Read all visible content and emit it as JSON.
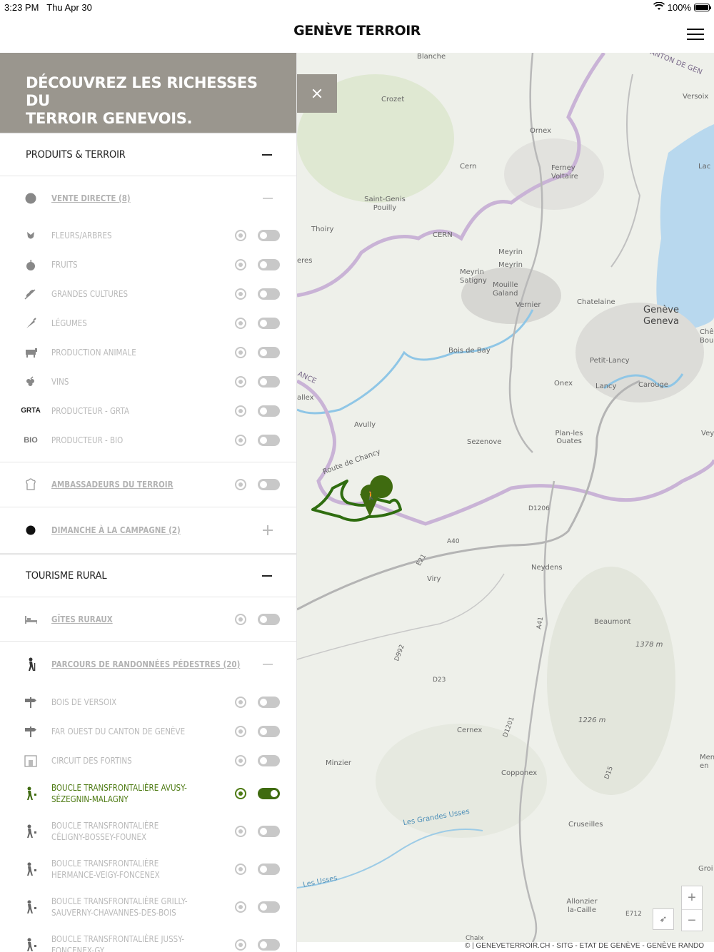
{
  "status": {
    "time": "3:23 PM",
    "date": "Thu Apr 30",
    "battery": "100%"
  },
  "header": {
    "brand": "GENÈVE TERROIR"
  },
  "banner": {
    "line1": "DÉCOUVREZ LES RICHESSES DU",
    "line2": "TERROIR GENEVOIS."
  },
  "sections": {
    "produits": "PRODUITS & TERROIR",
    "tourisme": "TOURISME RURAL"
  },
  "vente": {
    "title": "VENTE DIRECTE (8)",
    "items": [
      "FLEURS/ARBRES",
      "FRUITS",
      "GRANDES CULTURES",
      "LÉGUMES",
      "PRODUCTION ANIMALE",
      "VINS",
      "PRODUCTEUR - GRTA",
      "PRODUCTEUR - BIO"
    ]
  },
  "ambassadeurs": "AMBASSADEURS DU TERROIR",
  "dimanche": "DIMANCHE À LA CAMPAGNE (2)",
  "gites": "GÎTES RURAUX",
  "parcours": {
    "title": "PARCOURS DE RANDONNÉES PÉDESTRES (20)",
    "items": [
      {
        "label": "BOIS DE VERSOIX",
        "active": false
      },
      {
        "label": "FAR OUEST DU CANTON DE GENÈVE",
        "active": false
      },
      {
        "label": "CIRCUIT DES FORTINS",
        "active": false
      },
      {
        "label": "BOUCLE TRANSFRONTALIÈRE AVUSY-SÉZEGNIN-MALAGNY",
        "active": true
      },
      {
        "label": "BOUCLE TRANSFRONTALIÈRE CÉLIGNY-BOSSEY-FOUNEX",
        "active": false
      },
      {
        "label": "BOUCLE TRANSFRONTALIÈRE HERMANCE-VEIGY-FONCENEX",
        "active": false
      },
      {
        "label": "BOUCLE TRANSFRONTALIÈRE GRILLY-SAUVERNY-CHAVANNES-DES-BOIS",
        "active": false
      },
      {
        "label": "BOUCLE TRANSFRONTALIÈRE JUSSY-FONCENEX-GY",
        "active": false
      }
    ]
  },
  "icons": {
    "grta": "GRTA",
    "bio": "BIO"
  },
  "map": {
    "labels": [
      "Blanche",
      "Crozet",
      "Ornex",
      "Versoix",
      "Cern",
      "Ferney Voltaire",
      "Lac",
      "Saint-Genis Pouilly",
      "Thoiry",
      "CERN",
      "Meyrin",
      "Meyrin",
      "Meyrin Satigny",
      "Mouille Galand",
      "Vernier",
      "Chatelaine",
      "Genève",
      "Geneva",
      "Bois de Bay",
      "Petit-Lancy",
      "Onex",
      "Lancy",
      "Carouge",
      "Avully",
      "Sezenove",
      "Plan-les Ouates",
      "Route de Chancy",
      "Neydens",
      "Viry",
      "Beaumont",
      "1378 m",
      "1226 m",
      "Cernex",
      "Minzier",
      "Copponex",
      "Les Grandes Usses",
      "Cruseilles",
      "Allonzier la-Caille",
      "Les Usses",
      "Chê Bouge",
      "Vey",
      "Men en",
      "Groi",
      "ANCE",
      "allex",
      "eres",
      "ANTON DE GEN",
      "D1206",
      "A40",
      "E21",
      "A41",
      "D992",
      "D23",
      "D1201",
      "D15",
      "E712",
      "Chaix"
    ],
    "attribution": "© | GENEVETERROIR.CH - SITG - ETAT DE GENÈVE - GENÈVE RANDO",
    "zoom_in": "+",
    "zoom_out": "−"
  },
  "colors": {
    "banner": "#9a968e",
    "active": "#4d7a12",
    "toggle_on": "#3f6b10"
  }
}
